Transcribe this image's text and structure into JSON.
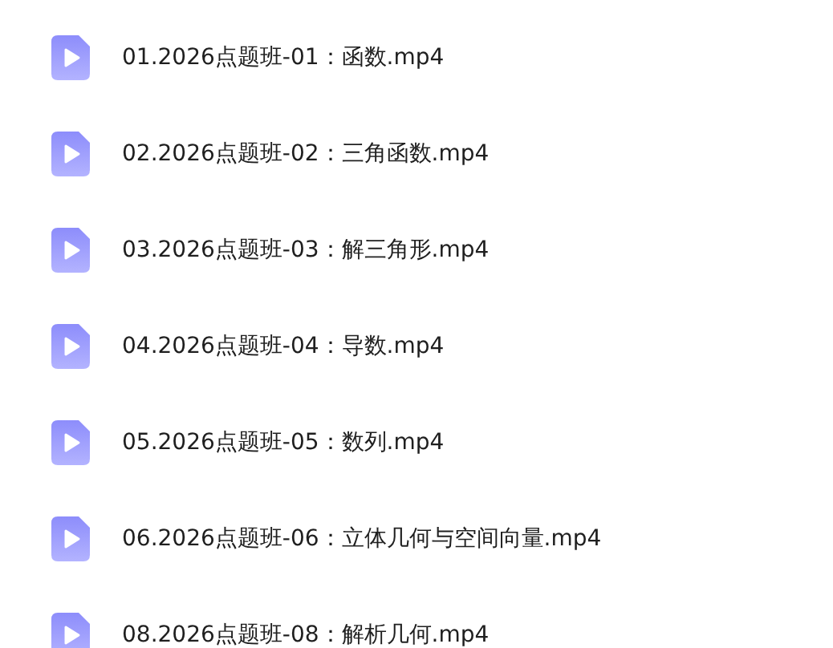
{
  "files": [
    {
      "name": "01.2026点题班-01：函数.mp4"
    },
    {
      "name": "02.2026点题班-02：三角函数.mp4"
    },
    {
      "name": "03.2026点题班-03：解三角形.mp4"
    },
    {
      "name": "04.2026点题班-04：导数.mp4"
    },
    {
      "name": "05.2026点题班-05：数列.mp4"
    },
    {
      "name": "06.2026点题班-06：立体几何与空间向量.mp4"
    },
    {
      "name": "08.2026点题班-08：解析几何.mp4"
    }
  ]
}
